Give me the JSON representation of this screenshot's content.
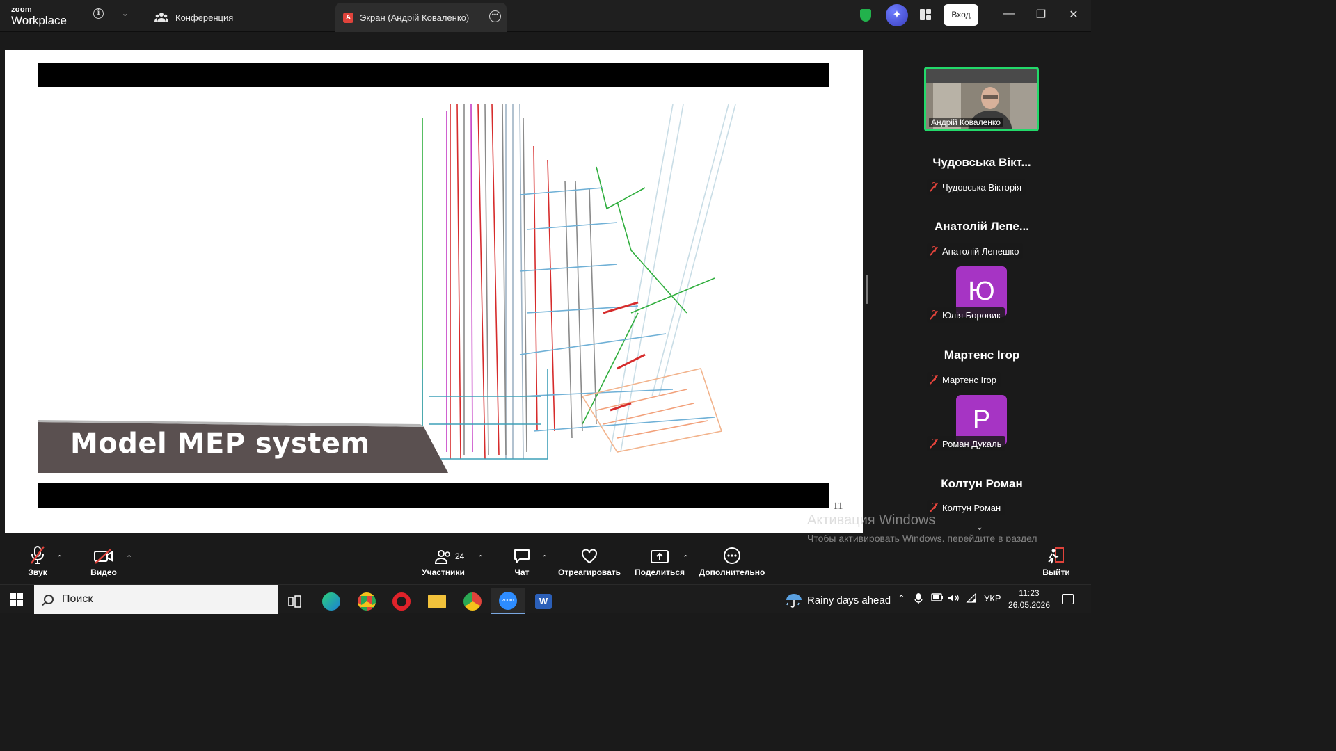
{
  "topbar": {
    "logo_small": "zoom",
    "logo_big": "Workplace",
    "tab_conference": "Конференция",
    "tab_screen": "Экран (Андрій Коваленко)",
    "tab_screen_badge": "A",
    "signin": "Вход"
  },
  "slide": {
    "title": "Model MEP system",
    "page_number": "11"
  },
  "gallery": {
    "video": {
      "name": "Андрій Коваленко"
    },
    "participants": [
      {
        "display": "Чудовська Вікт...",
        "label": "Чудовська Вікторія",
        "muted": true
      },
      {
        "display": "Анатолій Лепе...",
        "label": "Анатолій Лепешко",
        "muted": true
      },
      {
        "avatar_letter": "Ю",
        "label": "Юлія Боровик",
        "muted": true
      },
      {
        "display": "Мартенс Ігор",
        "label": "Мартенс Ігор",
        "muted": true
      },
      {
        "avatar_letter": "Р",
        "label": "Роман Дукаль",
        "muted": true
      },
      {
        "display": "Колтун Роман",
        "label": "Колтун Роман",
        "muted": true
      }
    ]
  },
  "watermark": {
    "title": "Активация Windows",
    "text": "Чтобы активировать Windows, перейдите в раздел \"Параметры\"."
  },
  "controls": {
    "audio": "Звук",
    "video": "Видео",
    "participants": "Участники",
    "participants_count": "24",
    "chat": "Чат",
    "react": "Отреагировать",
    "share": "Поделиться",
    "more": "Дополнительно",
    "leave": "Выйти"
  },
  "taskbar": {
    "search_placeholder": "Поиск",
    "weather": "Rainy days ahead",
    "language": "УКР",
    "time": "11:23",
    "date": "26.05.2026"
  },
  "colors": {
    "accent_green": "#23d96a",
    "avatar_purple": "#a634c4",
    "mute_red": "#e0433b",
    "leave_red": "#e0433b",
    "ai_blue": "#4f5bff"
  }
}
